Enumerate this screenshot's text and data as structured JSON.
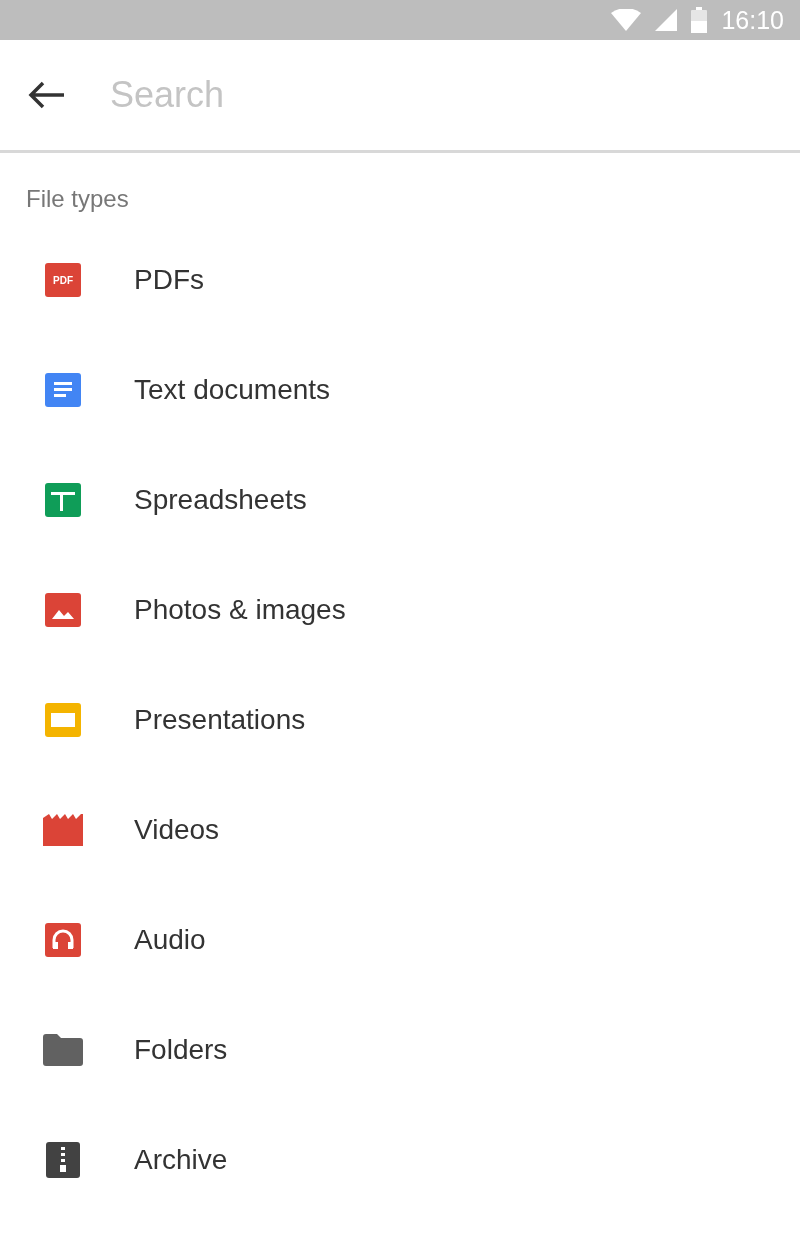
{
  "status_bar": {
    "time": "16:10"
  },
  "search": {
    "placeholder": "Search"
  },
  "section": {
    "title": "File types"
  },
  "items": [
    {
      "kind": "pdf",
      "label": "PDFs",
      "badge": "PDF"
    },
    {
      "kind": "doc",
      "label": "Text documents"
    },
    {
      "kind": "sheet",
      "label": "Spreadsheets"
    },
    {
      "kind": "image",
      "label": "Photos & images"
    },
    {
      "kind": "slides",
      "label": "Presentations"
    },
    {
      "kind": "video",
      "label": "Videos"
    },
    {
      "kind": "audio",
      "label": "Audio"
    },
    {
      "kind": "folder",
      "label": "Folders"
    },
    {
      "kind": "archive",
      "label": "Archive"
    }
  ]
}
